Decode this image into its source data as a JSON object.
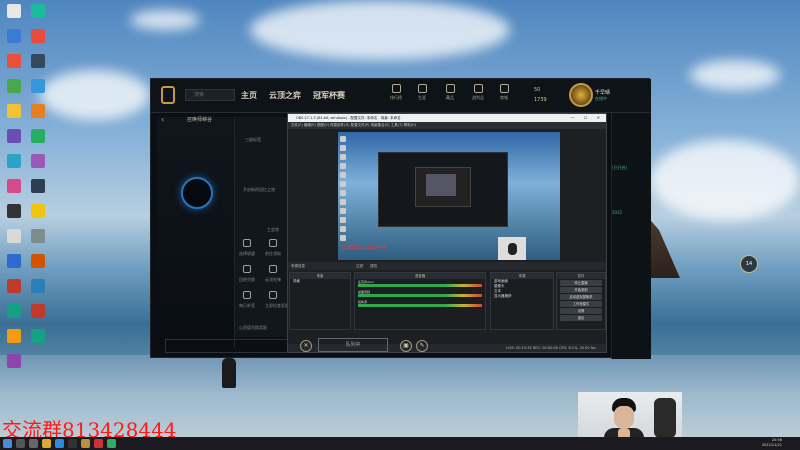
{
  "desktop": {
    "icons": [
      "",
      "",
      "",
      "",
      "",
      "",
      "",
      "",
      "",
      "",
      "",
      "",
      "",
      "",
      "",
      "",
      "",
      "",
      "",
      "",
      "",
      "",
      "",
      "",
      "",
      "",
      "",
      "",
      ""
    ],
    "overlay_text": "交流群813428444"
  },
  "lol_client": {
    "search_placeholder": "搜索",
    "nav": [
      "主页",
      "云顶之弈",
      "冠军杯赛"
    ],
    "top_icons": [
      "排行榜",
      "生涯",
      "藏品",
      "战利品",
      "商城"
    ],
    "currency_1": "50",
    "currency_2": "1739",
    "username": "千早晴",
    "user_status": "在线中",
    "club_label": "召唤师峡谷",
    "left_mid_labels": [
      "三级标签",
      "开启新的回忆之旅",
      "工会商",
      "选择联盟",
      "前往领取",
      "回馈兑换",
      "云顶先锋",
      "每日补签",
      "立即检查奖励",
      "心愿值兑换奖励"
    ],
    "queue_button": "队列中",
    "right_badge": "14",
    "right_texts": [
      "(已开启)",
      "2022"
    ]
  },
  "obs": {
    "title": "OBS 27.1.3 (64-bit, windows) - 配置文件: 未命名 - 场景: 未命名",
    "menu": "文件(F)  编辑(E)  视图(V)  停靠部件(D)  配置文件(P)  场景集合(S)  工具(T)  帮助(H)",
    "preview_red_text": "交流群813428444",
    "dock_labels": [
      "来源信息",
      "过滤",
      "属性"
    ],
    "columns": {
      "scenes": "场景",
      "sources": "来源",
      "mixer": "混音器",
      "transitions": "转场",
      "controls": "控件"
    },
    "scene_items": [
      "场景"
    ],
    "source_items": [
      "游戏画面",
      "摄像头",
      "文本",
      "显示器捕获"
    ],
    "mixer_items": [
      "麦克风/Aux",
      "桌面音频",
      "媒体源"
    ],
    "control_buttons": [
      "停止直播",
      "开始录制",
      "启动虚拟摄像机",
      "工作室模式",
      "设置",
      "退出"
    ],
    "status": "LIVE: 00:15:32   REC: 00:00:00   CPU: 8.1%, 30.00 fps"
  },
  "taskbar": {
    "time": "20:56",
    "date": "2022/11/21"
  }
}
